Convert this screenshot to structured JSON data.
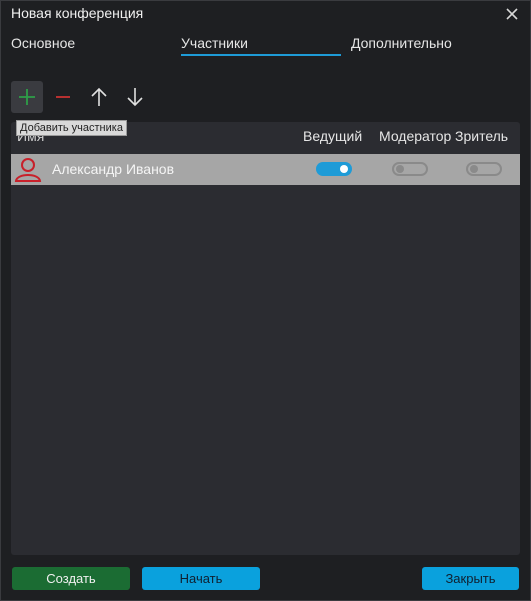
{
  "window": {
    "title": "Новая конференция"
  },
  "tabs": [
    {
      "label": "Основное"
    },
    {
      "label": "Участники"
    },
    {
      "label": "Дополнительно"
    }
  ],
  "toolbar": {
    "tooltip": "Добавить участника",
    "icons": [
      "plus-icon",
      "minus-icon",
      "arrow-up-icon",
      "arrow-down-icon"
    ]
  },
  "table": {
    "columns": [
      "Имя",
      "Ведущий",
      "Модератор",
      "Зритель"
    ],
    "rows": [
      {
        "name": "Александр Иванов",
        "host": true,
        "moderator": false,
        "viewer": false
      }
    ]
  },
  "buttons": {
    "create": "Создать",
    "start": "Начать",
    "close": "Закрыть"
  },
  "colors": {
    "accent": "#1e9bd7",
    "create": "#1b6c33",
    "add_icon": "#2e9e48",
    "remove_icon": "#c83232",
    "avatar": "#c8202a"
  }
}
